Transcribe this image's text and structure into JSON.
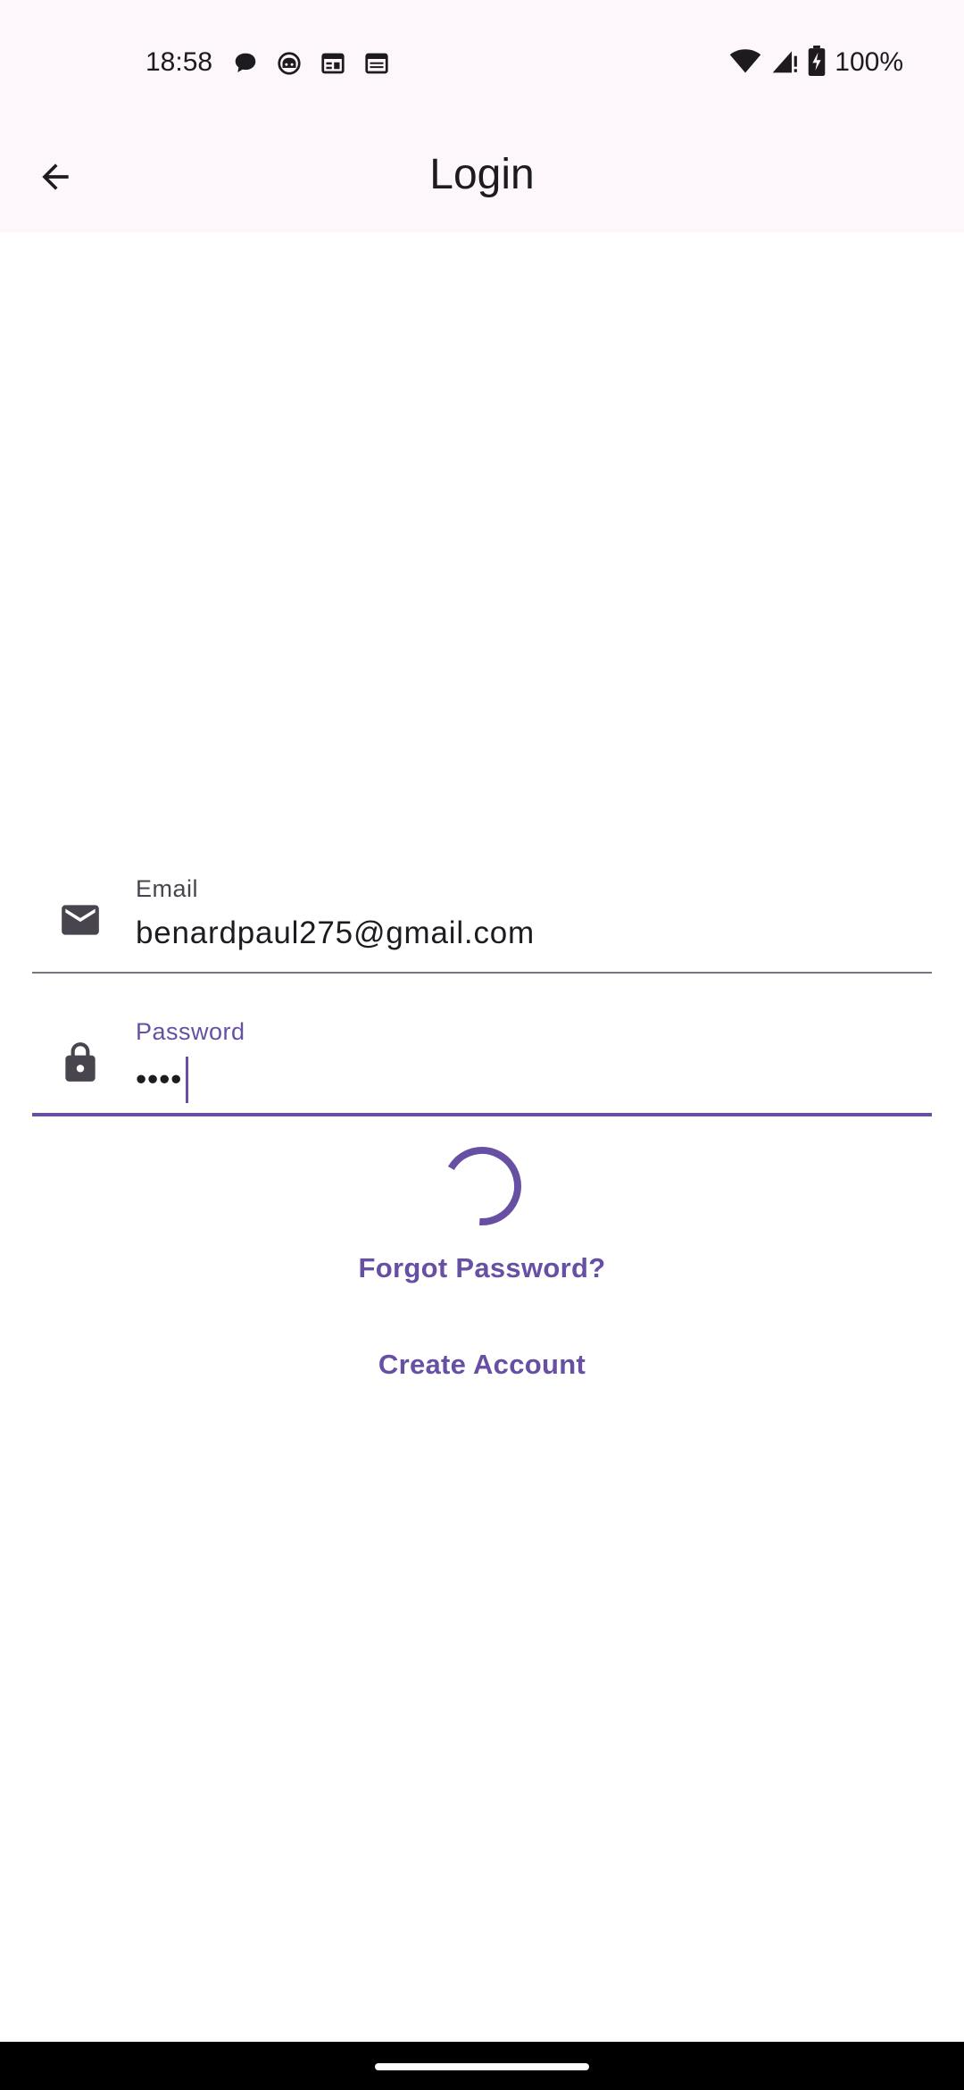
{
  "status_bar": {
    "time": "18:58",
    "notification_icons": [
      "chat-bubble-icon",
      "robot-face-icon",
      "calendar-icon",
      "calendar-icon"
    ],
    "battery_percent": "100%"
  },
  "app_bar": {
    "title": "Login",
    "back_icon": "arrow-back-icon"
  },
  "form": {
    "email": {
      "label": "Email",
      "value": "benardpaul275@gmail.com",
      "icon": "mail-icon"
    },
    "password": {
      "label": "Password",
      "value": "••••",
      "icon": "lock-icon",
      "focused": true
    }
  },
  "loading": true,
  "links": {
    "forgot_password": "Forgot Password?",
    "create_account": "Create Account"
  },
  "colors": {
    "primary": "#6750a4",
    "top_background": "#fdf7fc",
    "text": "#1d1b20",
    "outline": "#79747e"
  }
}
